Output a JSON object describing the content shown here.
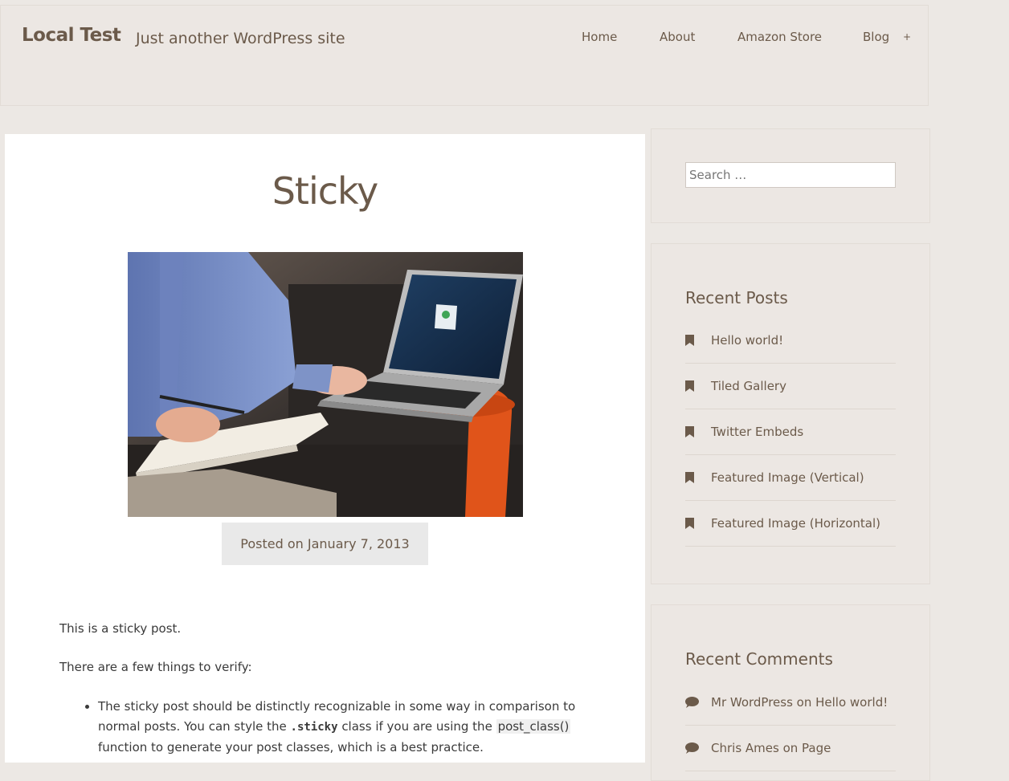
{
  "site": {
    "title": "Local Test",
    "description": "Just another WordPress site"
  },
  "nav": {
    "items": [
      {
        "label": "Home"
      },
      {
        "label": "About"
      },
      {
        "label": "Amazon Store"
      },
      {
        "label": "Blog"
      }
    ],
    "submenu_toggle": "+"
  },
  "post": {
    "title": "Sticky",
    "posted_prefix": "Posted on",
    "date": "January 7, 2013",
    "paragraphs": [
      "This is a sticky post.",
      "There are a few things to verify:"
    ],
    "list": {
      "item1_part1": "The sticky post should be distinctly recognizable in some way in comparison to normal posts. You can style the ",
      "item1_code": ".sticky",
      "item1_part2": " class if you are using the ",
      "item1_func": "post_class()",
      "item1_part3": " function to generate your post classes, which is a best practice."
    }
  },
  "sidebar": {
    "search_placeholder": "Search …",
    "recent_posts": {
      "title": "Recent Posts",
      "items": [
        "Hello world!",
        "Tiled Gallery",
        "Twitter Embeds",
        "Featured Image (Vertical)",
        "Featured Image (Horizontal)"
      ]
    },
    "recent_comments": {
      "title": "Recent Comments",
      "items": [
        "Mr WordPress on Hello world!",
        "Chris Ames on Page"
      ]
    }
  },
  "colors": {
    "background": "#ece8e4",
    "text": "#6b5a4a",
    "accent_orange": "#e0541a"
  },
  "icons": {
    "post_item": "bookmark-icon",
    "comment_item": "speech-bubble-icon"
  }
}
